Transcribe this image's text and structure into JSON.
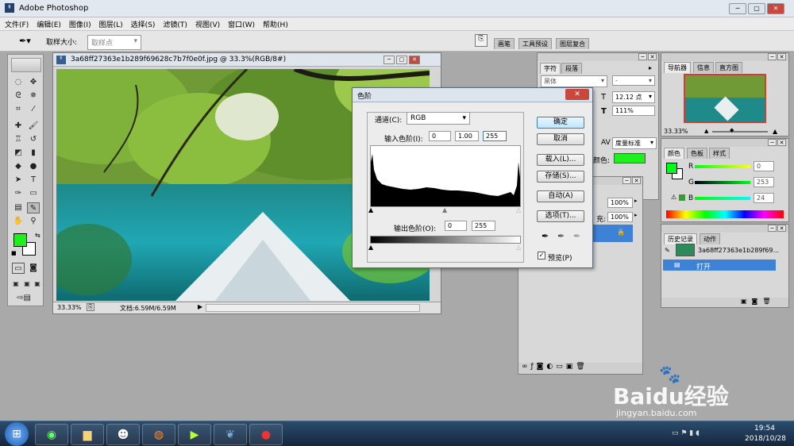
{
  "app": {
    "title": "Adobe Photoshop"
  },
  "menu": [
    "文件(F)",
    "编辑(E)",
    "图像(I)",
    "图层(L)",
    "选择(S)",
    "滤镜(T)",
    "视图(V)",
    "窗口(W)",
    "帮助(H)"
  ],
  "options": {
    "sample_label": "取样大小:",
    "sample_value": "取样点"
  },
  "palette_well_tabs": [
    "画笔",
    "工具预设",
    "图层复合"
  ],
  "document": {
    "title": "3a68ff27363e1b289f69628c7b7f0e0f.jpg @ 33.3%(RGB/8#)",
    "zoom": "33.33%",
    "doc_info": "文档:6.59M/6.59M"
  },
  "char_panel": {
    "tabs": [
      "字符",
      "段落"
    ],
    "font": "黑体",
    "style": "-",
    "size": "12.12 点",
    "leading": "111%",
    "color_label": "颜色:",
    "measure": "度量标准",
    "color_hex": "#1ef01e"
  },
  "layers_panel": {
    "opacity": "100%",
    "fill": "100%",
    "fill_label": "充:"
  },
  "levels_dialog": {
    "title": "色阶",
    "channel_label": "通道(C):",
    "channel_value": "RGB",
    "input_label": "输入色阶(I):",
    "input_values": [
      "0",
      "1.00",
      "255"
    ],
    "output_label": "输出色阶(O):",
    "output_values": [
      "0",
      "255"
    ],
    "buttons": {
      "ok": "确定",
      "cancel": "取消",
      "load": "载入(L)...",
      "save": "存储(S)...",
      "auto": "自动(A)",
      "options": "选项(T)..."
    },
    "preview_label": "预览(P)",
    "preview_checked": true
  },
  "navigator": {
    "tabs": [
      "导航器",
      "信息",
      "直方图"
    ],
    "zoom": "33.33%"
  },
  "color_panel": {
    "tabs": [
      "颜色",
      "色板",
      "样式"
    ],
    "r_label": "R",
    "g_label": "G",
    "b_label": "B",
    "r": "0",
    "g": "253",
    "b": "24",
    "fg_color": "#00fd18"
  },
  "history_panel": {
    "tabs": [
      "历史记录",
      "动作"
    ],
    "snapshot": "3a68ff27363e1b289f69...",
    "step": "打开"
  },
  "taskbar": {
    "time": "19:54",
    "date": "2018/10/28"
  },
  "watermark": {
    "brand": "Baidu经验",
    "url": "jingyan.baidu.com"
  }
}
